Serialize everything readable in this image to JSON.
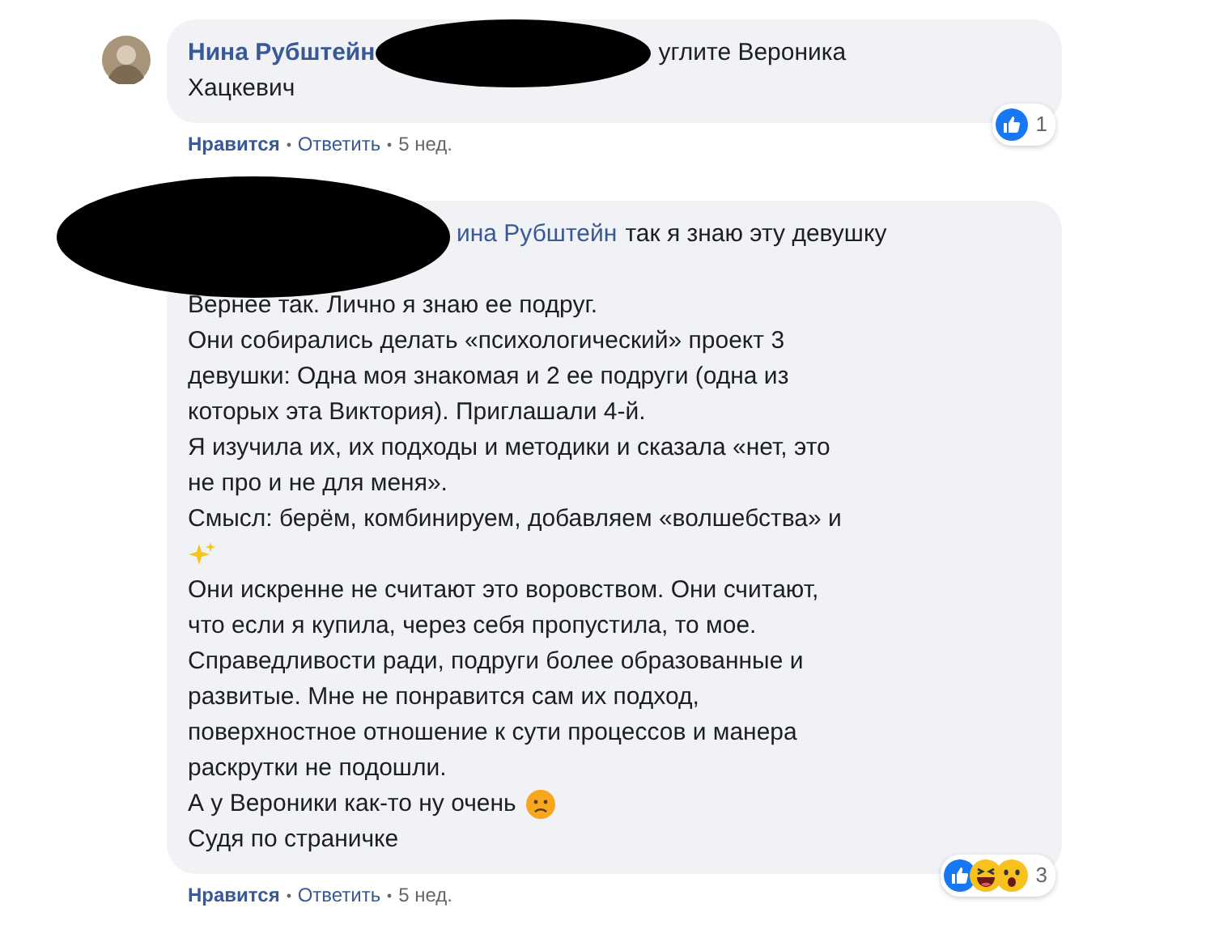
{
  "comments": [
    {
      "author": "Нина Рубштейн",
      "header_text": "углите Вероника",
      "lines": [
        {
          "kind": "text",
          "text": "Хацкевич"
        }
      ],
      "actions": {
        "like": "Нравится",
        "reply": "Ответить",
        "time": "5 нед."
      },
      "reactions": {
        "count": "1",
        "icons": [
          {
            "kind": "like"
          }
        ]
      },
      "redaction": {
        "kind": "inline"
      }
    },
    {
      "author": "ина Рубштейн",
      "header_text": "так я знаю эту девушку",
      "lines": [
        {
          "kind": "blank"
        },
        {
          "kind": "text",
          "text": "Вернее так. Лично я знаю ее подруг."
        },
        {
          "kind": "text",
          "text": "Они собирались делать «психологический» проект 3"
        },
        {
          "kind": "text",
          "text": "девушки: Одна моя знакомая и 2 ее подруги (одна из"
        },
        {
          "kind": "text",
          "text": "которых эта Виктория). Приглашали 4-й."
        },
        {
          "kind": "text",
          "text": "Я изучила их, их подходы и методики и сказала «нет, это"
        },
        {
          "kind": "text",
          "text": "не про и не для меня»."
        },
        {
          "kind": "text",
          "text": "Смысл: берём, комбинируем, добавляем «волшебства» и"
        },
        {
          "kind": "sparkles"
        },
        {
          "kind": "text",
          "text": "Они искренне не считают это воровством. Они считают,"
        },
        {
          "kind": "text",
          "text": "что если я купила, через себя пропустила, то мое."
        },
        {
          "kind": "text",
          "text": "Справедливости ради, подруги более образованные и"
        },
        {
          "kind": "text",
          "text": "развитые. Мне не понравится сам их подход,"
        },
        {
          "kind": "text",
          "text": "поверхностное отношение к сути процессов и манера"
        },
        {
          "kind": "text",
          "text": "раскрутки не подошли."
        },
        {
          "kind": "text_sad",
          "text": "А у Вероники как-то ну очень"
        },
        {
          "kind": "text",
          "text": "Судя по страничке"
        }
      ],
      "actions": {
        "like": "Нравится",
        "reply": "Ответить",
        "time": "5 нед."
      },
      "reactions": {
        "count": "3",
        "icons": [
          {
            "kind": "like"
          },
          {
            "kind": "haha"
          },
          {
            "kind": "wow"
          }
        ]
      },
      "redaction": {
        "kind": "avatar"
      }
    }
  ]
}
